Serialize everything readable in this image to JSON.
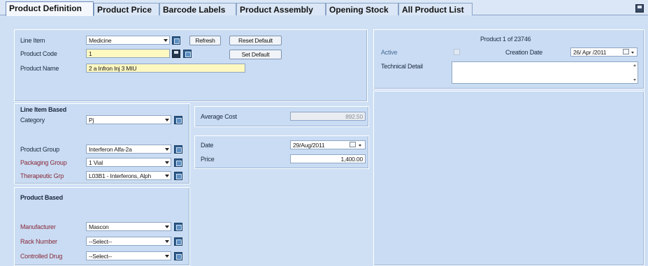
{
  "tabs": [
    {
      "label": "Product Definition",
      "active": true
    },
    {
      "label": "Product Price"
    },
    {
      "label": "Barcode Labels"
    },
    {
      "label": "Product Assembly"
    },
    {
      "label": "Opening Stock"
    },
    {
      "label": "All Product List"
    }
  ],
  "top": {
    "line_item_label": "Line Item",
    "line_item_value": "Medicine",
    "product_code_label": "Product Code",
    "product_code_value": "1",
    "product_name_label": "Product Name",
    "product_name_value": "2 a Infron Inj 3 MIU",
    "refresh_label": "Refresh",
    "reset_default_label": "Reset Default",
    "set_default_label": "Set Default"
  },
  "line_item_based": {
    "heading": "Line Item Based",
    "category_label": "Category",
    "category_value": "Pj",
    "product_group_label": "Product Group",
    "product_group_value": "Interferon Alfa-2a",
    "packaging_group_label": "Packaging Group",
    "packaging_group_value": "1 Vial",
    "therapeutic_grp_label": "Therapeutic Grp",
    "therapeutic_grp_value": "L03B1 - Interferons, Alph"
  },
  "product_based": {
    "heading": "Product Based",
    "manufacturer_label": "Manufacturer",
    "manufacturer_value": "Mascon",
    "rack_number_label": "Rack Number",
    "rack_number_value": "--Select--",
    "controlled_drug_label": "Controlled Drug",
    "controlled_drug_value": "--Select--"
  },
  "cost": {
    "average_cost_label": "Average Cost",
    "average_cost_value": "892.50"
  },
  "price": {
    "date_label": "Date",
    "date_value": "29/Aug/2011",
    "price_label": "Price",
    "price_value": "1,400.00"
  },
  "right": {
    "record_counter": "Product 1 of 23746",
    "active_label": "Active",
    "active_checked": false,
    "creation_date_label": "Creation Date",
    "creation_date_value": "26/ Apr /2011",
    "technical_detail_label": "Technical Detail",
    "technical_detail_value": ""
  }
}
